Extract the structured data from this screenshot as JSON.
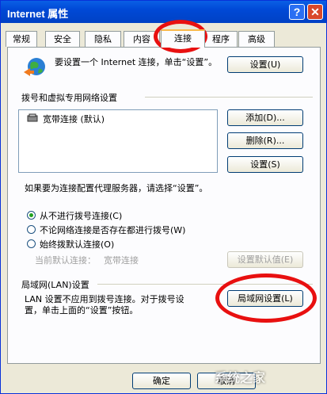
{
  "window": {
    "title": "Internet 属性",
    "help_label": "?",
    "close_label": "✕"
  },
  "tabs": [
    {
      "label": "常规"
    },
    {
      "label": "安全"
    },
    {
      "label": "隐私"
    },
    {
      "label": "内容"
    },
    {
      "label": "连接",
      "active": true
    },
    {
      "label": "程序"
    },
    {
      "label": "高级"
    }
  ],
  "setup": {
    "text": "要设置一个 Internet 连接，单击“设置”。",
    "button": "设置(U)"
  },
  "dialup": {
    "section_title": "拨号和虚拟专用网络设置",
    "connections": [
      {
        "label": "宽带连接 (默认)"
      }
    ],
    "add_button": "添加(D)...",
    "remove_button": "删除(R)...",
    "settings_button": "设置(S)",
    "proxy_text": "如果要为连接配置代理服务器，请选择“设置”。",
    "radios": [
      {
        "label": "从不进行拨号连接(C)",
        "selected": true
      },
      {
        "label": "不论网络连接是否存在都进行拨号(W)",
        "selected": false
      },
      {
        "label": "始终拨默认连接(O)",
        "selected": false
      }
    ],
    "current_default_label": "当前默认连接：",
    "current_default_value": "宽带连接",
    "set_default_button": "设置默认值(E)"
  },
  "lan": {
    "section_title": "局域网(LAN)设置",
    "text_line1": "LAN 设置不应用到拨号连接。对于拨号设",
    "text_line2": "置，单击上面的“设置”按钮。",
    "button": "局域网设置(L)"
  },
  "footer": {
    "ok_button": "确定",
    "cancel_button": "取消",
    "watermark": "系统之家"
  },
  "colors": {
    "titlebar": "#0049d6",
    "annotation_circle": "#e81010",
    "radio_selected": "#21a121"
  }
}
